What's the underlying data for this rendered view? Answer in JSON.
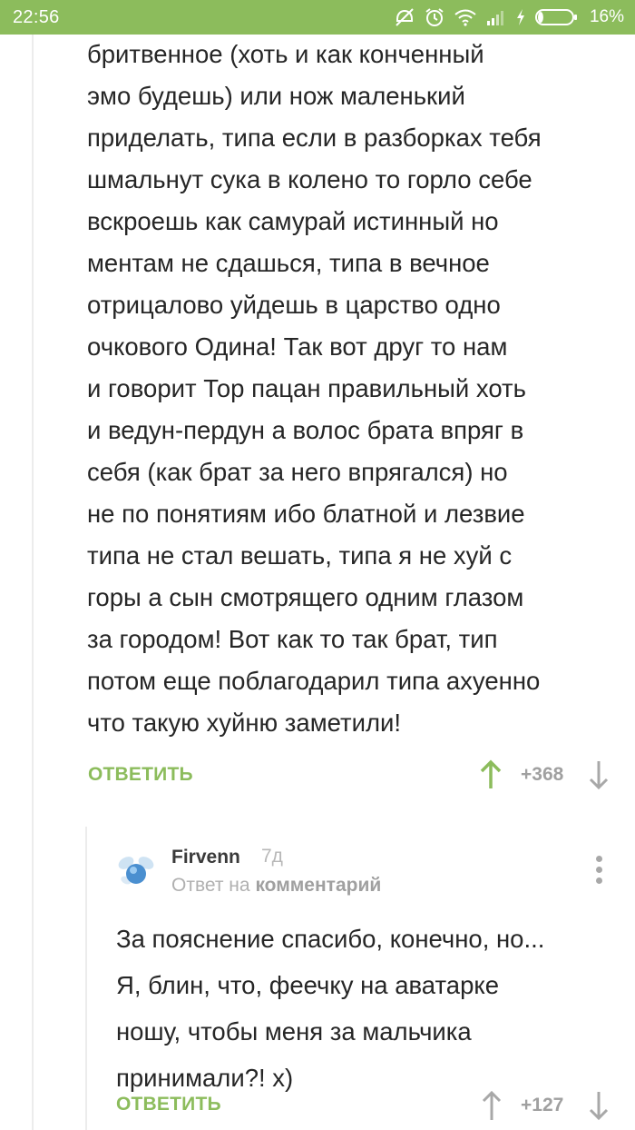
{
  "status_bar": {
    "time": "22:56",
    "battery_percent": "16%",
    "battery_level": 0.16,
    "icons": [
      "dnd-icon",
      "alarm-icon",
      "wifi-icon",
      "signal-icon",
      "charging-icon",
      "battery-icon"
    ]
  },
  "colors": {
    "accent": "#8cbc5c",
    "text": "#262626",
    "muted": "#a0a0a0"
  },
  "comment_1": {
    "lines": [
      "бритвенное (хоть и как конченный",
      "эмо будешь) или нож маленький",
      "приделать, типа если в разборках тебя",
      "шмальнут сука в колено то горло себе",
      "вскроешь как самурай истинный но",
      "ментам не сдашься, типа в вечное",
      "отрицалово уйдешь в царство одно",
      "очкового Одина! Так вот друг то нам",
      "и говорит Тор пацан правильный хоть",
      "и ведун-пердун а волос брата впряг в",
      "себя (как брат за него впрягался) но",
      "не по понятиям ибо блатной и лезвие",
      "типа не стал вешать, типа я не хуй с",
      "горы а сын смотрящего одним глазом",
      "за городом! Вот как то так брат, тип",
      "потом еще поблагодарил типа ахуенно",
      "что такую хуйню заметили!"
    ],
    "reply_label": "ОТВЕТИТЬ",
    "rating": "+368"
  },
  "comment_2": {
    "author": "Firvenn",
    "age": "7д",
    "reply_prefix": "Ответ на",
    "reply_target": "комментарий",
    "lines": [
      "За пояснение спасибо, конечно, но...",
      "Я, блин, что, феечку на аватарке",
      "ношу, чтобы меня за мальчика",
      "принимали?! х)"
    ],
    "reply_label": "ОТВЕТИТЬ",
    "rating": "+127"
  }
}
